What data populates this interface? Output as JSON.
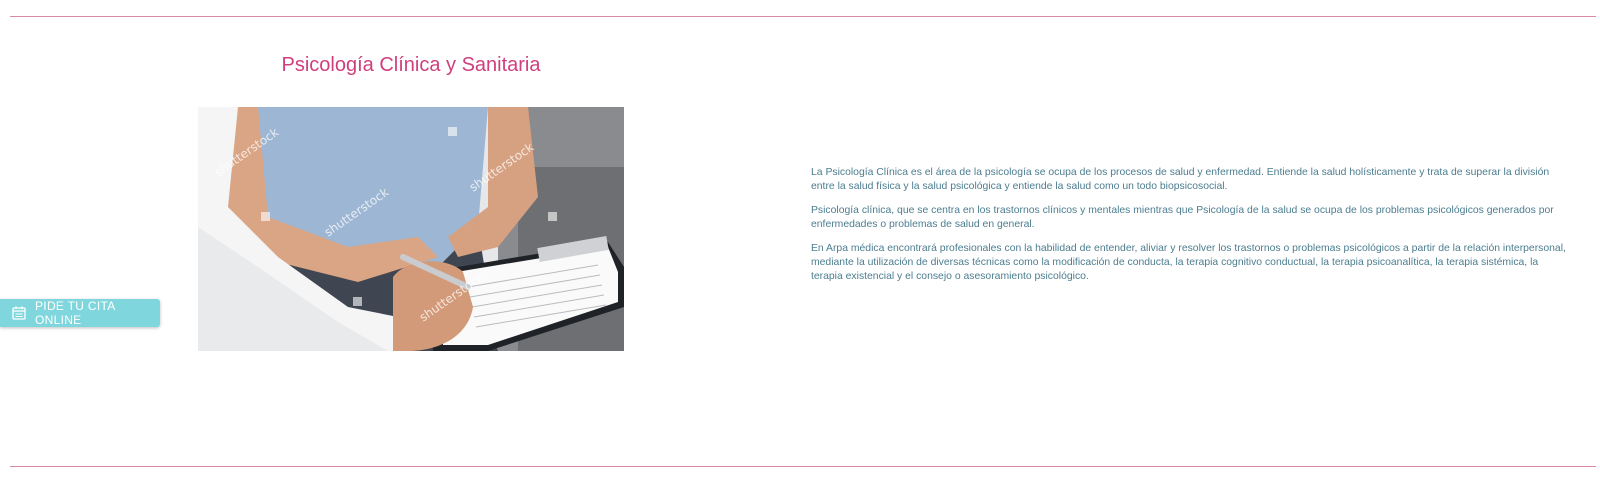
{
  "section": {
    "title": "Psicología Clínica y Sanitaria"
  },
  "image": {
    "icon": "stock-photo-doctor-writing-clipboard",
    "watermark": "shutterstock"
  },
  "content": {
    "paragraphs": [
      "La Psicología Clínica es el área de la psicología se ocupa de los procesos de salud y enfermedad. Entiende la salud holísticamente y trata de superar la división entre la salud física y la salud psicológica y entiende la salud como un todo biopsicosocial.",
      "Psicología clínica, que se centra en los trastornos clínicos y mentales mientras que Psicología de la salud se ocupa de los problemas psicológicos generados por enfermedades o problemas de salud en general.",
      "En Arpa médica encontrará profesionales con la habilidad de entender, aliviar y resolver los trastornos o problemas psicológicos a partir de la relación interpersonal, mediante la utilización de diversas técnicas como la modificación de conducta, la terapia cognitivo conductual, la terapia psicoanalítica, la terapia sistémica, la terapia existencial y el consejo o asesoramiento psicológico."
    ]
  },
  "cta": {
    "label": "PIDE TU CITA ONLINE",
    "icon": "calendar-icon"
  },
  "colors": {
    "accent": "#cf3f7e",
    "text": "#4c7d8f",
    "rule": "#d98aa8",
    "cta_bg": "#7fd7dd"
  }
}
